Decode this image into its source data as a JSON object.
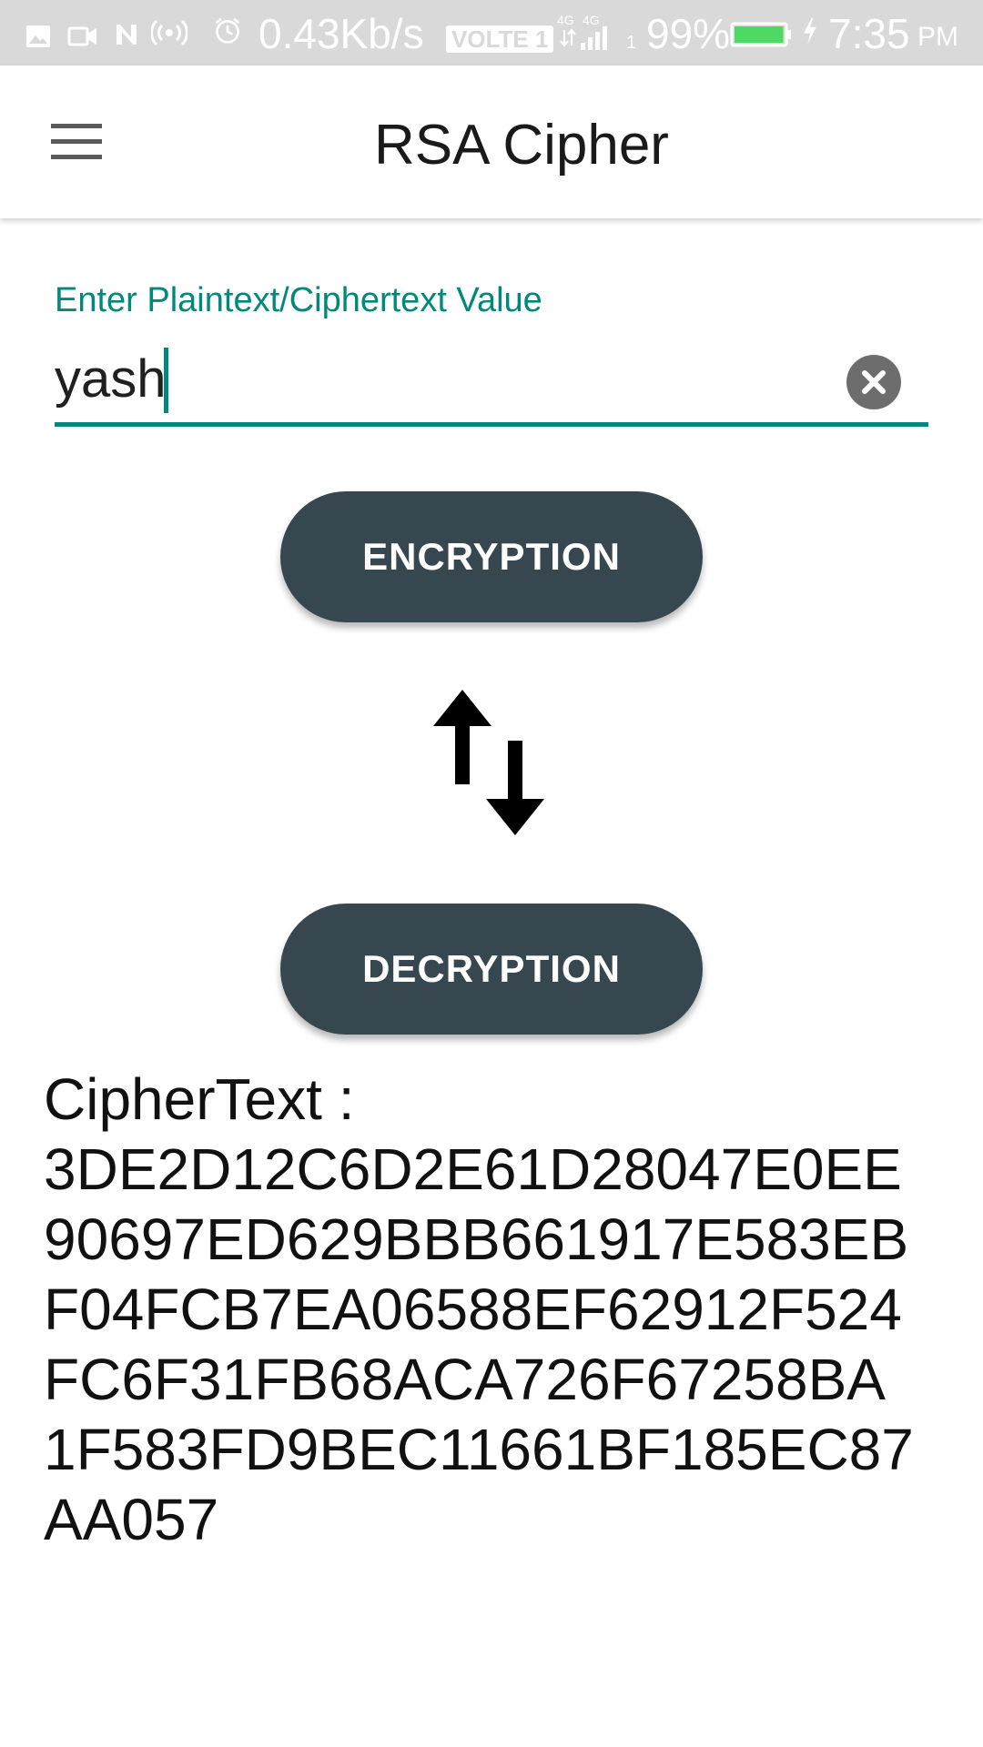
{
  "status_bar": {
    "speed": "0.43Kb/s",
    "volte": "VOLTE 1",
    "network_1": "4G",
    "network_2": "4G",
    "sim_index": "1",
    "battery_percent": "99%",
    "battery_level": 0.99,
    "battery_color": "#4cd964",
    "time": "7:35",
    "ampm": "PM",
    "icons": [
      "image-icon",
      "video-icon",
      "nfc-icon",
      "hotspot-icon",
      "alarm-icon",
      "signal-icon",
      "battery-icon",
      "charging-icon"
    ]
  },
  "app_bar": {
    "title": "RSA Cipher",
    "menu_icon": "hamburger-menu-icon"
  },
  "input": {
    "label": "Enter Plaintext/Ciphertext Value",
    "value": "yash",
    "clear_icon": "clear-circle-icon",
    "accent_color": "#00897b"
  },
  "buttons": {
    "encrypt_label": "ENCRYPTION",
    "decrypt_label": "DECRYPTION",
    "color": "#37474f"
  },
  "swap_icon": "swap-vertical-icon",
  "output": {
    "lines": [
      "CipherText :",
      "3DE2D12C6D2E61D28047E0EE",
      "90697ED629BBB661917E583EB",
      "F04FCB7EA06588EF62912F524",
      "FC6F31FB68ACA726F67258BA",
      "1F583FD9BEC11661BF185EC87",
      "AA057"
    ]
  }
}
